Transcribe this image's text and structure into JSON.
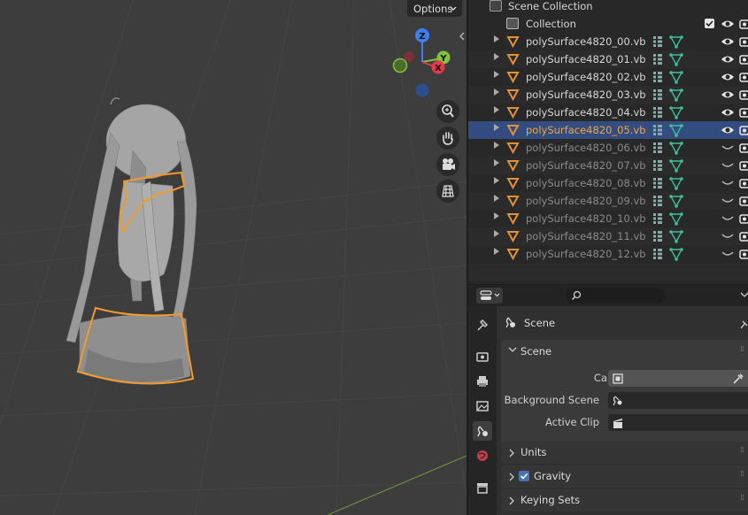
{
  "viewport": {
    "options_label": "Options",
    "gizmo": {
      "z_label": "Z",
      "y_label": "Y",
      "x_label": "X"
    }
  },
  "outliner": {
    "scene_collection_label": "Scene Collection",
    "collection_label": "Collection",
    "objects": [
      {
        "name": "polySurface4820_00.vb",
        "visible": true,
        "selected": false
      },
      {
        "name": "polySurface4820_01.vb",
        "visible": true,
        "selected": false
      },
      {
        "name": "polySurface4820_02.vb",
        "visible": true,
        "selected": false
      },
      {
        "name": "polySurface4820_03.vb",
        "visible": true,
        "selected": false
      },
      {
        "name": "polySurface4820_04.vb",
        "visible": true,
        "selected": false
      },
      {
        "name": "polySurface4820_05.vb",
        "visible": true,
        "selected": true
      },
      {
        "name": "polySurface4820_06.vb",
        "visible": false,
        "selected": false
      },
      {
        "name": "polySurface4820_07.vb",
        "visible": false,
        "selected": false
      },
      {
        "name": "polySurface4820_08.vb",
        "visible": false,
        "selected": false
      },
      {
        "name": "polySurface4820_09.vb",
        "visible": false,
        "selected": false
      },
      {
        "name": "polySurface4820_10.vb",
        "visible": false,
        "selected": false
      },
      {
        "name": "polySurface4820_11.vb",
        "visible": false,
        "selected": false
      },
      {
        "name": "polySurface4820_12.vb",
        "visible": false,
        "selected": false
      }
    ]
  },
  "properties": {
    "context_title": "Scene",
    "scene_panel": {
      "title": "Scene",
      "camera_label": "Camera",
      "background_scene_label": "Background Scene",
      "active_clip_label": "Active Clip"
    },
    "units_label": "Units",
    "gravity_label": "Gravity",
    "keying_sets_label": "Keying Sets"
  },
  "colors": {
    "selection_outline": "#f29a2e",
    "selected_row": "#334d80",
    "mesh_icon": "#3fbf9a",
    "object_icon": "#e0913a",
    "axis_x": "#e5384a",
    "axis_y": "#7fc43c",
    "axis_z": "#3c7ff0"
  }
}
